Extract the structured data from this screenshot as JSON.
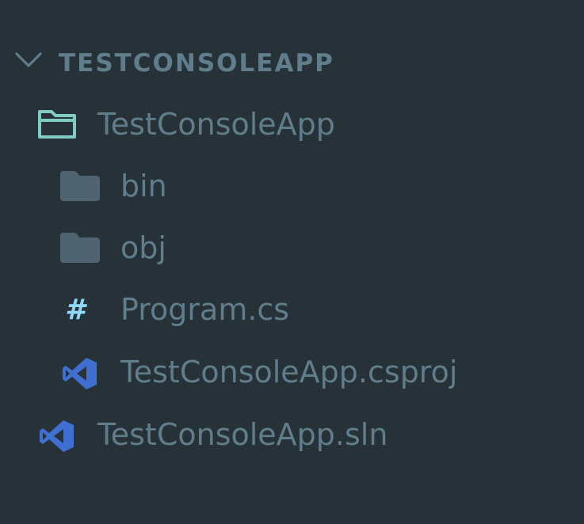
{
  "explorer": {
    "section_title": "TESTCONSOLEAPP",
    "items": [
      {
        "label": "TestConsoleApp",
        "icon": "folder-open-icon",
        "kind": "folder-open"
      },
      {
        "label": "bin",
        "icon": "folder-icon",
        "kind": "folder"
      },
      {
        "label": "obj",
        "icon": "folder-icon",
        "kind": "folder"
      },
      {
        "label": "Program.cs",
        "icon": "csharp-hash-icon",
        "kind": "file",
        "glyph": "#"
      },
      {
        "label": "TestConsoleApp.csproj",
        "icon": "visual-studio-icon",
        "kind": "file"
      },
      {
        "label": "TestConsoleApp.sln",
        "icon": "visual-studio-icon",
        "kind": "file"
      }
    ]
  },
  "colors": {
    "background": "#263238",
    "text": "#607d8b",
    "open_folder": "#80cbc4",
    "closed_folder": "#4f6470",
    "csharp": "#90d8f8",
    "visual_studio": "#3e6fd1"
  }
}
